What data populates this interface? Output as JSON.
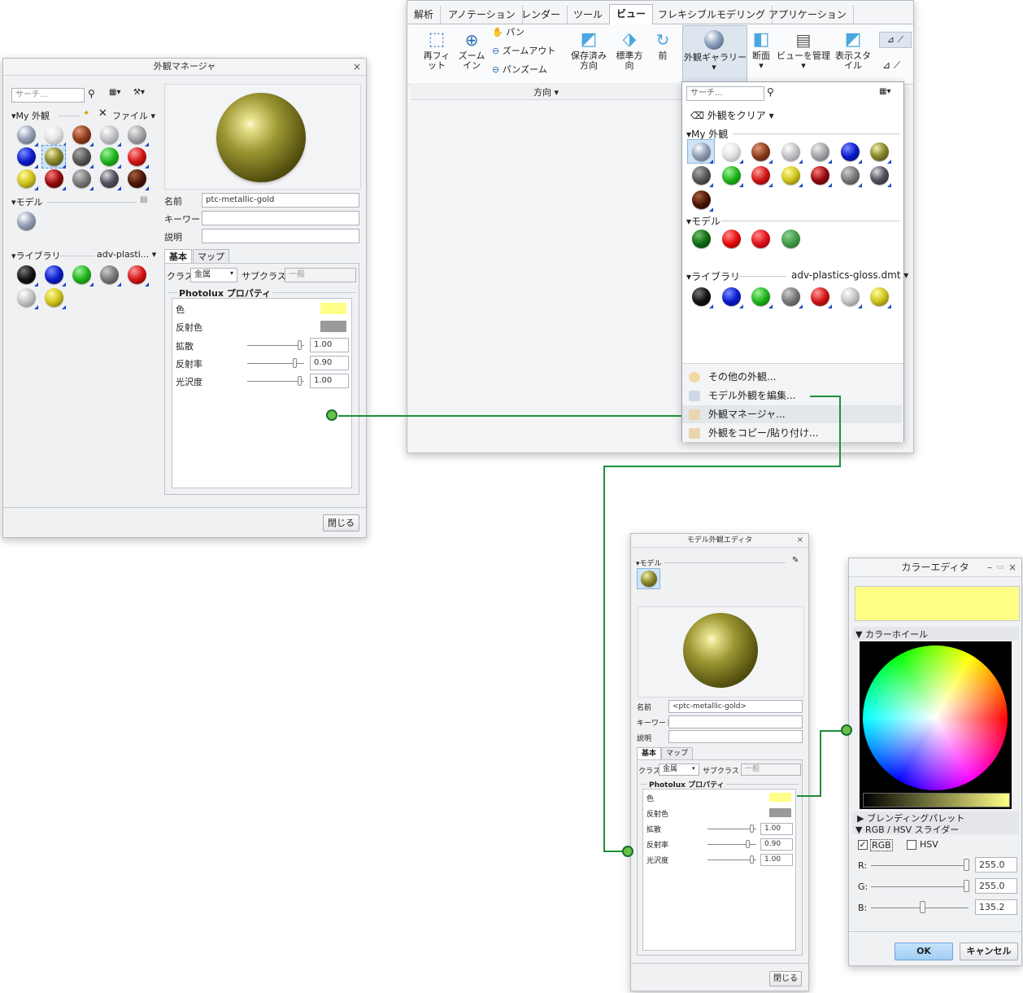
{
  "colors": {
    "accent_green": "#1f8f3a",
    "gold": "#8d8a2e",
    "pale_yellow": "#ffff87",
    "ok_blue": "#a9d4f6"
  },
  "left": {
    "title": "外観マネージャ",
    "search_placeholder": "サーチ...",
    "my_label": "My 外観",
    "file_label": "ファイル",
    "model_label": "モデル",
    "library_label": "ライブラリ",
    "library_file": "adv-plasti...",
    "name_label": "名前",
    "name_value": "ptc-metallic-gold",
    "keyword_label": "キーワード",
    "desc_label": "説明",
    "tab_basic": "基本",
    "tab_map": "マップ",
    "class_label": "クラス",
    "class_value": "金属",
    "subclass_label": "サブクラス",
    "subclass_value": "一般",
    "props_title": "Photolux プロパティ",
    "props": {
      "color": "色",
      "reflect": "反射色",
      "diffuse": "拡散",
      "diffuse_v": "1.00",
      "refl_rate": "反射率",
      "refl_rate_v": "0.90",
      "gloss": "光沢度",
      "gloss_v": "1.00"
    },
    "close": "閉じる"
  },
  "ribbon": {
    "tabs": [
      "解析",
      "アノテーション",
      "レンダー",
      "ツール",
      "ビュー",
      "フレキシブルモデリング",
      "アプリケーション"
    ],
    "refit": "再フィット",
    "zoomin": "ズームイン",
    "pan": "パン",
    "zoomout": "ズームアウト",
    "panzoom": "パンズーム",
    "saved_view": "保存済み方向",
    "std_view": "標準方向",
    "prev": "前",
    "gallery": "外観ギャラリー",
    "section": "断面",
    "view_mgr": "ビューを管理",
    "display_style": "表示スタイル",
    "orientation": "方向"
  },
  "gallery": {
    "search_placeholder": "サーチ...",
    "clear": "外観をクリア",
    "my_label": "My 外観",
    "model_label": "モデル",
    "library_label": "ライブラリ",
    "library_file": "adv-plastics-gloss.dmt",
    "menu": [
      "その他の外観...",
      "モデル外観を編集...",
      "外観マネージャ...",
      "外観をコピー/貼り付け..."
    ]
  },
  "mid": {
    "title": "モデル外観エディタ",
    "model_label": "モデル",
    "name_label": "名前",
    "name_value": "<ptc-metallic-gold>",
    "keyword_label": "キーワード",
    "desc_label": "説明",
    "tab_basic": "基本",
    "tab_map": "マップ",
    "class_label": "クラス",
    "class_value": "金属",
    "subclass_label": "サブクラス",
    "subclass_value": "一般",
    "props_title": "Photolux プロパティ",
    "props": {
      "color": "色",
      "reflect": "反射色",
      "diffuse": "拡散",
      "diffuse_v": "1.00",
      "refl_rate": "反射率",
      "refl_rate_v": "0.90",
      "gloss": "光沢度",
      "gloss_v": "1.00"
    },
    "close": "閉じる"
  },
  "color_editor": {
    "title": "カラーエディタ",
    "wheel": "カラーホイール",
    "blend": "ブレンディングパレット",
    "sliders": "RGB / HSV スライダー",
    "rgb": "RGB",
    "hsv": "HSV",
    "r_label": "R:",
    "r": "255.0",
    "r_frac": 1.0,
    "g_label": "G:",
    "g": "255.0",
    "g_frac": 1.0,
    "b_label": "B:",
    "b": "135.2",
    "b_frac": 0.53,
    "ok": "OK",
    "cancel": "キャンセル"
  }
}
